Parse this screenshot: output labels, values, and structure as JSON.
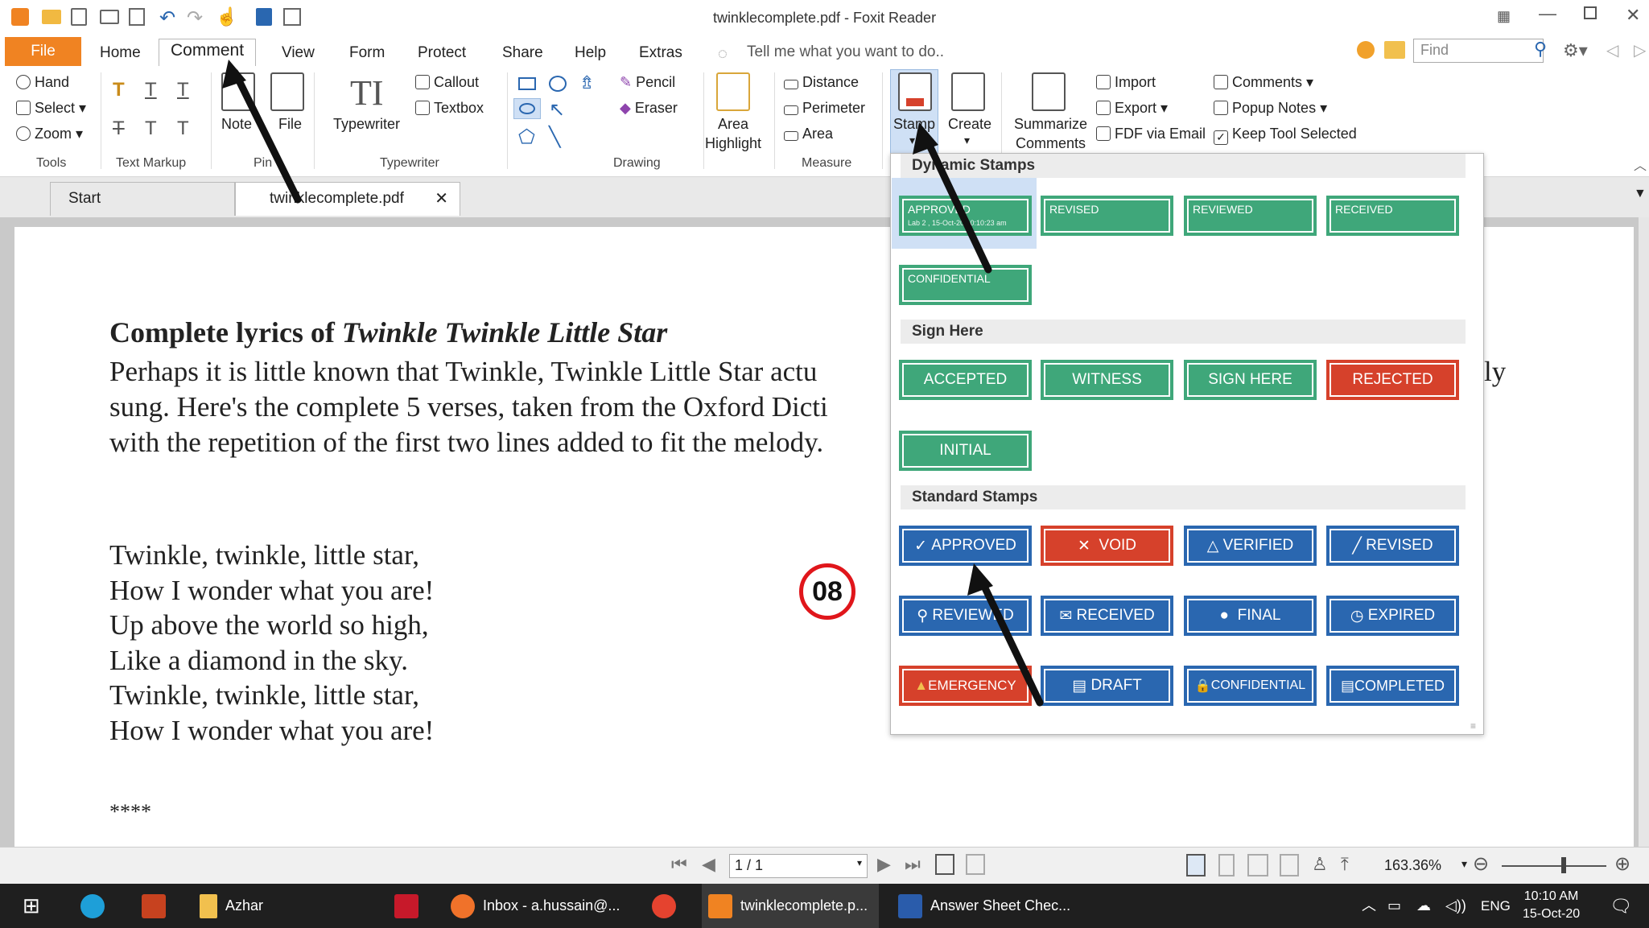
{
  "titlebar": {
    "title": "twinklecomplete.pdf - Foxit Reader"
  },
  "tabs": {
    "file": "File",
    "home": "Home",
    "comment": "Comment",
    "view": "View",
    "form": "Form",
    "protect": "Protect",
    "share": "Share",
    "help": "Help",
    "extras": "Extras",
    "tell": "Tell me what you want to do..",
    "find_placeholder": "Find"
  },
  "ribbon": {
    "hand": "Hand",
    "select": "Select",
    "zoom": "Zoom",
    "tools": "Tools",
    "textmarkup": "Text Markup",
    "note": "Note",
    "file": "File",
    "pin": "Pin",
    "typewriter": "Typewriter",
    "callout": "Callout",
    "textbox": "Textbox",
    "typewriter_grp": "Typewriter",
    "pencil": "Pencil",
    "eraser": "Eraser",
    "drawing": "Drawing",
    "area_highlight_1": "Area",
    "area_highlight_2": "Highlight",
    "distance": "Distance",
    "perimeter": "Perimeter",
    "area": "Area",
    "measure": "Measure",
    "stamp": "Stamp",
    "create": "Create",
    "summarize_1": "Summarize",
    "summarize_2": "Comments",
    "import": "Import",
    "export": "Export",
    "fdf": "FDF via Email",
    "comments": "Comments",
    "popup_notes": "Popup Notes",
    "keep_tool": "Keep Tool Selected"
  },
  "doctabs": {
    "start": "Start",
    "current": "twinklecomplete.pdf"
  },
  "document": {
    "heading_a": "Complete lyrics of ",
    "heading_b": "Twinkle Twinkle Little Star",
    "p1": "Perhaps it is little known that Twinkle, Twinkle Little Star actu",
    "p1_end": "ly",
    "p2": "sung. Here's the complete 5 verses, taken from the Oxford Dicti",
    "p3": "with the repetition of the first two lines added to fit the melody.",
    "v1": "Twinkle, twinkle, little star,",
    "v2": "How I wonder what you are!",
    "v3": "Up above the world so high,",
    "v4": "Like a diamond in the sky.",
    "v5": "Twinkle, twinkle, little star,",
    "v6": "How I wonder what you are!",
    "stars": "****",
    "badge": "08"
  },
  "stamps": {
    "dynamic_header": "Dynamic Stamps",
    "dyn_approved": "APPROVED",
    "dyn_approved_sub": "Lab 2 , 15-Oct-20 10:10:23 am",
    "dyn_revised": "REVISED",
    "dyn_reviewed": "REVIEWED",
    "dyn_received": "RECEIVED",
    "dyn_confidential": "CONFIDENTIAL",
    "sign_header": "Sign Here",
    "accepted": "ACCEPTED",
    "witness": "WITNESS",
    "sign_here": "SIGN HERE",
    "rejected": "REJECTED",
    "initial": "INITIAL",
    "standard_header": "Standard Stamps",
    "approved": "APPROVED",
    "void": "VOID",
    "verified": "VERIFIED",
    "revised": "REVISED",
    "reviewed": "REVIEWED",
    "received": "RECEIVED",
    "final": "FINAL",
    "expired": "EXPIRED",
    "emergency": "EMERGENCY",
    "draft": "DRAFT",
    "confidential": "CONFIDENTIAL",
    "completed": "COMPLETED"
  },
  "statusbar": {
    "page": "1 / 1",
    "zoom": "163.36%"
  },
  "taskbar": {
    "folder": "Azhar",
    "inbox": "Inbox - a.hussain@...",
    "foxit": "twinklecomplete.p...",
    "word": "Answer Sheet Chec...",
    "lang": "ENG",
    "time": "10:10 AM",
    "date": "15-Oct-20"
  },
  "colors": {
    "accent": "#f08322",
    "green": "#3fa77a",
    "red": "#d6412b",
    "blue": "#2a67b0"
  }
}
